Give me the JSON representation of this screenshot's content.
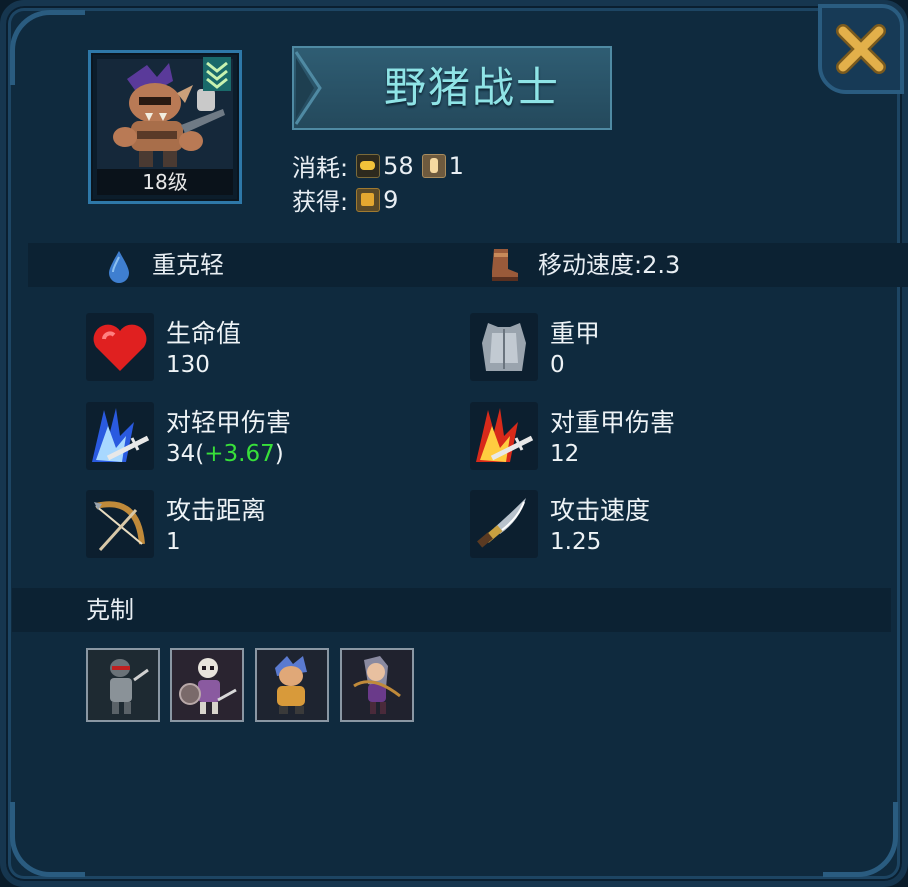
{
  "unit": {
    "name": "野猪战士",
    "level": "18级",
    "cost_label": "消耗:",
    "cost_gold": "58",
    "cost_pop": "1",
    "gain_label": "获得:",
    "gain_honor": "9"
  },
  "info_strip": {
    "armor_type": "重克轻",
    "move_speed": "移动速度:2.3"
  },
  "stats": [
    {
      "label": "生命值",
      "value": "130",
      "icon": "heart-icon"
    },
    {
      "label": "重甲",
      "value": "0",
      "icon": "armor-icon"
    },
    {
      "label": "对轻甲伤害",
      "value": "34",
      "bonus": "+3.67",
      "icon": "blue-slash-icon"
    },
    {
      "label": "对重甲伤害",
      "value": "12",
      "icon": "red-slash-icon"
    },
    {
      "label": "攻击距离",
      "value": "1",
      "icon": "bow-icon"
    },
    {
      "label": "攻击速度",
      "value": "1.25",
      "icon": "dagger-icon"
    }
  ],
  "counters": {
    "title": "克制",
    "units": [
      "ninja-unit",
      "skeleton-unit",
      "blue-haired-unit",
      "archer-girl-unit"
    ]
  },
  "colors": {
    "panel_bg": "#0f2a3e",
    "name_text": "#8fe4e6",
    "bonus_text": "#38e03a",
    "close_x": "#e3b04a"
  }
}
